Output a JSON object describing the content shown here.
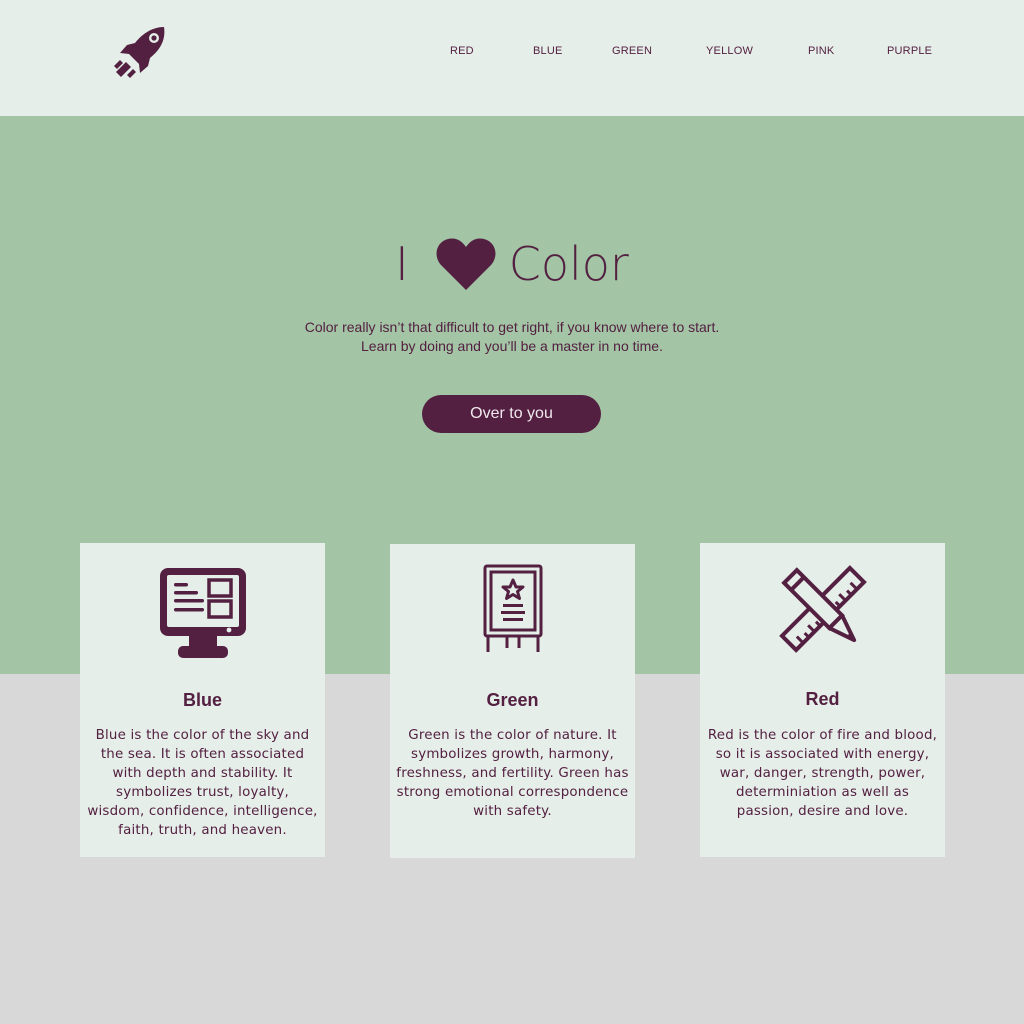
{
  "colors": {
    "accent": "#532041",
    "header_bg": "#e6eee9",
    "hero_bg": "#a3c4a5",
    "page_bg": "#d8d8d8",
    "card_bg": "#e6eee9"
  },
  "header": {
    "logo_icon": "rocket-icon",
    "nav": [
      {
        "label": "RED"
      },
      {
        "label": "BLUE"
      },
      {
        "label": "GREEN"
      },
      {
        "label": "YELLOW"
      },
      {
        "label": "PINK"
      },
      {
        "label": "PURPLE"
      }
    ]
  },
  "hero": {
    "title_pre": "I",
    "title_icon": "heart-icon",
    "title_post": "Color",
    "subtitle_line1": "Color really isn’t that difficult to get right, if you know where to start.",
    "subtitle_line2": "Learn by doing and you’ll be a master in no time.",
    "cta_label": "Over to you"
  },
  "cards": [
    {
      "icon": "monitor-icon",
      "title": "Blue",
      "text": "Blue is the color of the sky and the sea. It is often associated with depth and stability. It symbolizes trust, loyalty, wisdom, confidence, intelligence, faith, truth, and heaven."
    },
    {
      "icon": "easel-board-icon",
      "title": "Green",
      "text": "Green is the color of nature. It symbolizes growth, harmony, freshness, and fertility. Green has strong emotional correspondence with safety."
    },
    {
      "icon": "pencil-ruler-icon",
      "title": "Red",
      "text": "Red is the color of fire and blood, so it is associated with energy, war, danger, strength, power, determiniation as well as passion, desire and love."
    }
  ]
}
